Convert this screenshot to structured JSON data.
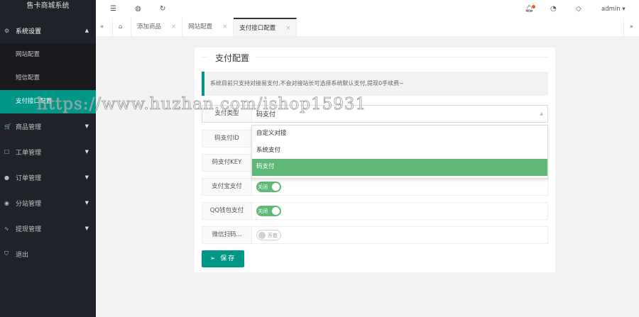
{
  "app_title": "售卡商城系统",
  "sidebar": {
    "group": {
      "label": "系统设置",
      "items": [
        "网站配置",
        "短信配置",
        "支付接口配置"
      ]
    },
    "menus": [
      "商品管理",
      "工单管理",
      "订单管理",
      "分站管理",
      "提现管理"
    ],
    "logout": "退出"
  },
  "header": {
    "user": "admin"
  },
  "tabs": [
    "添加商品",
    "网站配置",
    "支付接口配置"
  ],
  "card": {
    "title": "支付配置",
    "notice": "系统目前只支持对接易支付,不会对接站长可选择系统默认支付,提现0手续费~",
    "pay_type": {
      "label": "支付类型",
      "value": "码支付",
      "options": [
        "自定义对接",
        "系统支付",
        "码支付"
      ]
    },
    "fields": [
      {
        "label": "码支付ID"
      },
      {
        "label": "码支付KEY"
      }
    ],
    "switches": [
      {
        "label": "支付宝支付",
        "text": "关闭",
        "on": true
      },
      {
        "label": "QQ钱包支付",
        "text": "关闭",
        "on": true
      },
      {
        "label": "微信扫码...",
        "text": "开启",
        "on": false
      }
    ],
    "save": "保存"
  },
  "watermark": "https://www.huzhan.com/ishop15931",
  "colors": {
    "accent": "#009688",
    "green": "#5fb878",
    "sidebar": "#20222a"
  }
}
